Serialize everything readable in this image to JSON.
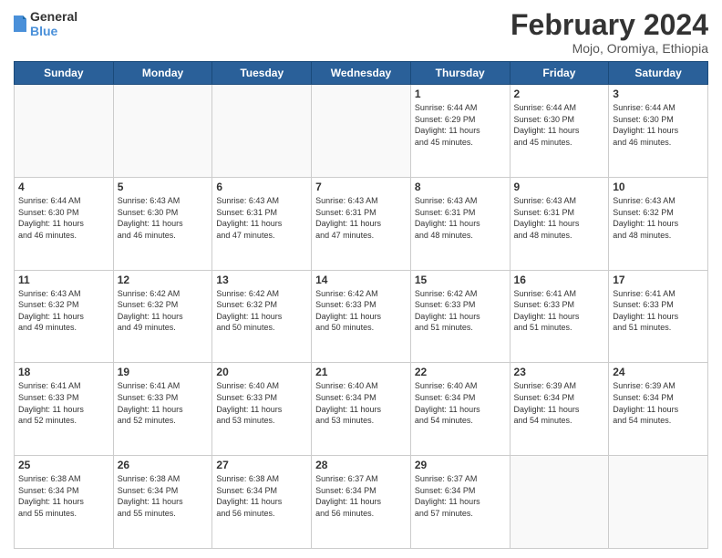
{
  "logo": {
    "line1": "General",
    "line2": "Blue"
  },
  "title": "February 2024",
  "location": "Mojo, Oromiya, Ethiopia",
  "days_of_week": [
    "Sunday",
    "Monday",
    "Tuesday",
    "Wednesday",
    "Thursday",
    "Friday",
    "Saturday"
  ],
  "weeks": [
    [
      {
        "day": "",
        "info": ""
      },
      {
        "day": "",
        "info": ""
      },
      {
        "day": "",
        "info": ""
      },
      {
        "day": "",
        "info": ""
      },
      {
        "day": "1",
        "info": "Sunrise: 6:44 AM\nSunset: 6:29 PM\nDaylight: 11 hours\nand 45 minutes."
      },
      {
        "day": "2",
        "info": "Sunrise: 6:44 AM\nSunset: 6:30 PM\nDaylight: 11 hours\nand 45 minutes."
      },
      {
        "day": "3",
        "info": "Sunrise: 6:44 AM\nSunset: 6:30 PM\nDaylight: 11 hours\nand 46 minutes."
      }
    ],
    [
      {
        "day": "4",
        "info": "Sunrise: 6:44 AM\nSunset: 6:30 PM\nDaylight: 11 hours\nand 46 minutes."
      },
      {
        "day": "5",
        "info": "Sunrise: 6:43 AM\nSunset: 6:30 PM\nDaylight: 11 hours\nand 46 minutes."
      },
      {
        "day": "6",
        "info": "Sunrise: 6:43 AM\nSunset: 6:31 PM\nDaylight: 11 hours\nand 47 minutes."
      },
      {
        "day": "7",
        "info": "Sunrise: 6:43 AM\nSunset: 6:31 PM\nDaylight: 11 hours\nand 47 minutes."
      },
      {
        "day": "8",
        "info": "Sunrise: 6:43 AM\nSunset: 6:31 PM\nDaylight: 11 hours\nand 48 minutes."
      },
      {
        "day": "9",
        "info": "Sunrise: 6:43 AM\nSunset: 6:31 PM\nDaylight: 11 hours\nand 48 minutes."
      },
      {
        "day": "10",
        "info": "Sunrise: 6:43 AM\nSunset: 6:32 PM\nDaylight: 11 hours\nand 48 minutes."
      }
    ],
    [
      {
        "day": "11",
        "info": "Sunrise: 6:43 AM\nSunset: 6:32 PM\nDaylight: 11 hours\nand 49 minutes."
      },
      {
        "day": "12",
        "info": "Sunrise: 6:42 AM\nSunset: 6:32 PM\nDaylight: 11 hours\nand 49 minutes."
      },
      {
        "day": "13",
        "info": "Sunrise: 6:42 AM\nSunset: 6:32 PM\nDaylight: 11 hours\nand 50 minutes."
      },
      {
        "day": "14",
        "info": "Sunrise: 6:42 AM\nSunset: 6:33 PM\nDaylight: 11 hours\nand 50 minutes."
      },
      {
        "day": "15",
        "info": "Sunrise: 6:42 AM\nSunset: 6:33 PM\nDaylight: 11 hours\nand 51 minutes."
      },
      {
        "day": "16",
        "info": "Sunrise: 6:41 AM\nSunset: 6:33 PM\nDaylight: 11 hours\nand 51 minutes."
      },
      {
        "day": "17",
        "info": "Sunrise: 6:41 AM\nSunset: 6:33 PM\nDaylight: 11 hours\nand 51 minutes."
      }
    ],
    [
      {
        "day": "18",
        "info": "Sunrise: 6:41 AM\nSunset: 6:33 PM\nDaylight: 11 hours\nand 52 minutes."
      },
      {
        "day": "19",
        "info": "Sunrise: 6:41 AM\nSunset: 6:33 PM\nDaylight: 11 hours\nand 52 minutes."
      },
      {
        "day": "20",
        "info": "Sunrise: 6:40 AM\nSunset: 6:33 PM\nDaylight: 11 hours\nand 53 minutes."
      },
      {
        "day": "21",
        "info": "Sunrise: 6:40 AM\nSunset: 6:34 PM\nDaylight: 11 hours\nand 53 minutes."
      },
      {
        "day": "22",
        "info": "Sunrise: 6:40 AM\nSunset: 6:34 PM\nDaylight: 11 hours\nand 54 minutes."
      },
      {
        "day": "23",
        "info": "Sunrise: 6:39 AM\nSunset: 6:34 PM\nDaylight: 11 hours\nand 54 minutes."
      },
      {
        "day": "24",
        "info": "Sunrise: 6:39 AM\nSunset: 6:34 PM\nDaylight: 11 hours\nand 54 minutes."
      }
    ],
    [
      {
        "day": "25",
        "info": "Sunrise: 6:38 AM\nSunset: 6:34 PM\nDaylight: 11 hours\nand 55 minutes."
      },
      {
        "day": "26",
        "info": "Sunrise: 6:38 AM\nSunset: 6:34 PM\nDaylight: 11 hours\nand 55 minutes."
      },
      {
        "day": "27",
        "info": "Sunrise: 6:38 AM\nSunset: 6:34 PM\nDaylight: 11 hours\nand 56 minutes."
      },
      {
        "day": "28",
        "info": "Sunrise: 6:37 AM\nSunset: 6:34 PM\nDaylight: 11 hours\nand 56 minutes."
      },
      {
        "day": "29",
        "info": "Sunrise: 6:37 AM\nSunset: 6:34 PM\nDaylight: 11 hours\nand 57 minutes."
      },
      {
        "day": "",
        "info": ""
      },
      {
        "day": "",
        "info": ""
      }
    ]
  ]
}
